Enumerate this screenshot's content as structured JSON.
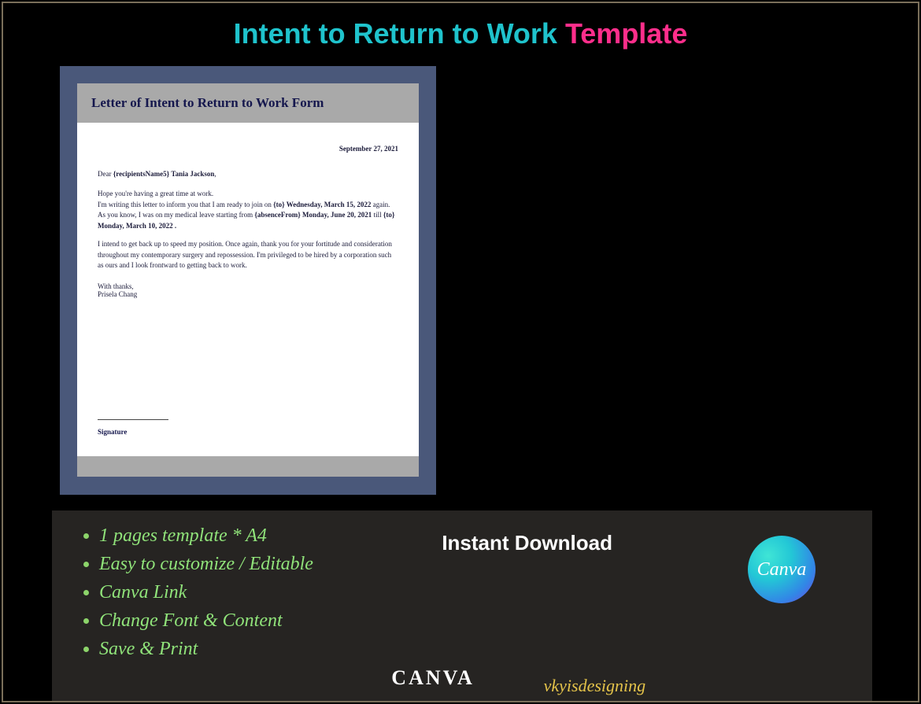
{
  "title": {
    "main": "Intent to Return to Work",
    "accent": "Template"
  },
  "document": {
    "header": "Letter of Intent to Return to Work Form",
    "date": "September 27, 2021",
    "salutation_prefix": "Dear",
    "salutation_token": "{recipientsName5}",
    "salutation_name": "Tania Jackson",
    "salutation_suffix": ",",
    "para1_a": "Hope you're having a great time at work.",
    "para1_b": "I'm writing this letter to inform you that I am ready to join on",
    "join_token": "{to} Wednesday, March 15, 2022",
    "para1_c": "again. As you know, I was on my medical leave starting from",
    "absence_from": "{absenceFrom} Monday, June 20, 2021",
    "till_word": "till",
    "absence_to": "{to} Monday, March 10, 2022 .",
    "para2": "I intend to get back up to speed my position. Once again, thank you for your fortitude and consideration throughout my contemporary surgery and repossession. I'm privileged to be hired by a corporation such as ours and I look frontward to getting back to work.",
    "close_a": "With thanks,",
    "close_b": "Prisela Chang",
    "signature_label": "Signature"
  },
  "features": [
    "1 pages template * A4",
    "Easy to customize / Editable",
    "Canva Link",
    "Change Font & Content",
    "Save & Print"
  ],
  "instant": "Instant Download",
  "canva_big": "CANVA",
  "brand": "vkyisdesigning",
  "canva_badge": "Canva"
}
